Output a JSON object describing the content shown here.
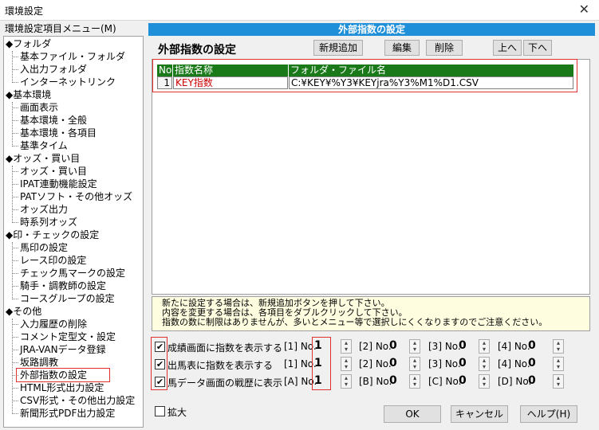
{
  "window": {
    "title": "環境設定",
    "close": "✕"
  },
  "menu": {
    "label": "環境設定項目メニュー(M)",
    "categories": [
      {
        "label": "◆フォルダ",
        "items": [
          "基本ファイル・フォルダ",
          "入出力フォルダ",
          "インターネットリンク"
        ]
      },
      {
        "label": "◆基本環境",
        "items": [
          "画面表示",
          "基本環境・全般",
          "基本環境・各項目",
          "基準タイム"
        ]
      },
      {
        "label": "◆オッズ・買い目",
        "items": [
          "オッズ・買い目",
          "IPAT連動機能設定",
          "PATソフト・その他オッズ",
          "オッズ出力",
          "時系列オッズ"
        ]
      },
      {
        "label": "◆印・チェックの設定",
        "items": [
          "馬印の設定",
          "レース印の設定",
          "チェック馬マークの設定",
          "騎手・調教師の設定",
          "コースグループの設定"
        ]
      },
      {
        "label": "◆その他",
        "items": [
          "入力履歴の削除",
          "コメント定型文・設定",
          "JRA-VANデータ登録",
          "坂路調教",
          "外部指数の設定",
          "HTML形式出力設定",
          "CSV形式・その他出力設定",
          "新聞形式PDF出力設定"
        ]
      }
    ]
  },
  "panel": {
    "header": "外部指数の設定",
    "title": "外部指数の設定",
    "buttons": {
      "add": "新規追加",
      "edit": "編集",
      "delete": "削除",
      "up": "上へ",
      "down": "下へ"
    },
    "table": {
      "headers": [
        "No.",
        "指数名称",
        "フォルダ・ファイル名"
      ],
      "rows": [
        {
          "no": "1",
          "name": "KEY指数",
          "path": "C:¥KEY¥%Y3¥KEYjra%Y3%M1%D1.CSV"
        }
      ]
    },
    "note": [
      "新たに設定する場合は、新規追加ボタンを押して下さい。",
      "内容を変更する場合は、各項目をダブルクリックして下さい。",
      "指数の数に制限はありませんが、多いとメニュー等で選択しにくくなりますのでご注意ください。"
    ]
  },
  "options": [
    {
      "label": "成績画面に指数を表示する",
      "checked": "✔",
      "slots": [
        {
          "tag": "[1] No.",
          "value": "1"
        },
        {
          "tag": "[2] No.",
          "value": "0"
        },
        {
          "tag": "[3] No.",
          "value": "0"
        },
        {
          "tag": "[4] No.",
          "value": "0"
        }
      ]
    },
    {
      "label": "出馬表に指数を表示する",
      "checked": "✔",
      "slots": [
        {
          "tag": "[1] No.",
          "value": "1"
        },
        {
          "tag": "[2] No.",
          "value": "0"
        },
        {
          "tag": "[3] No.",
          "value": "0"
        },
        {
          "tag": "[4] No.",
          "value": "0"
        }
      ]
    },
    {
      "label": "馬データ画面の戦歴に表示",
      "checked": "✔",
      "slots": [
        {
          "tag": "[A] No.",
          "value": "1"
        },
        {
          "tag": "[B] No.",
          "value": "0"
        },
        {
          "tag": "[C] No.",
          "value": "0"
        },
        {
          "tag": "[D] No.",
          "value": "0"
        }
      ]
    }
  ],
  "footer": {
    "zoom_label": "拡大",
    "ok": "OK",
    "cancel": "キャンセル",
    "help": "ヘルプ(H)"
  },
  "colors": {
    "accent": "#1e8fd8",
    "table_header": "#1a7a1a",
    "highlight": "#e03030",
    "name_text": "#cc0000",
    "note_bg": "#fffde0"
  }
}
